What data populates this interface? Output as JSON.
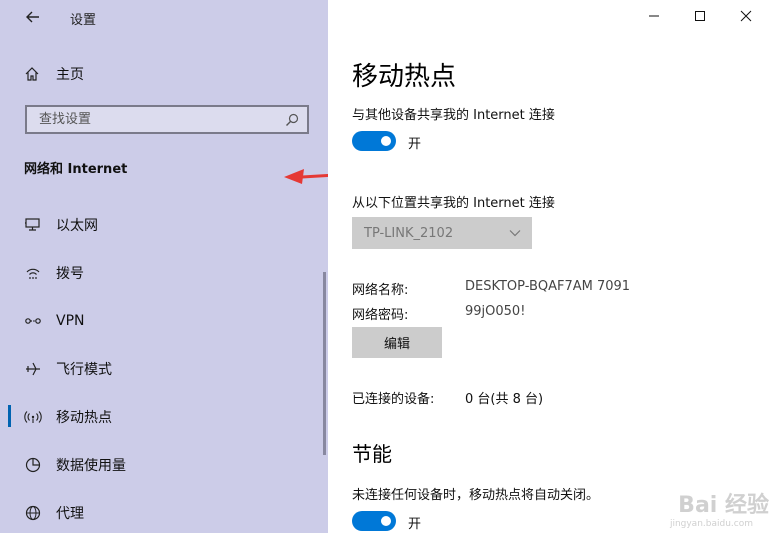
{
  "window": {
    "title": "设置"
  },
  "sidebar": {
    "home_label": "主页",
    "search_placeholder": "查找设置",
    "section_title": "网络和 Internet",
    "items": [
      {
        "label": "以太网",
        "icon": "ethernet-icon"
      },
      {
        "label": "拨号",
        "icon": "dialup-icon"
      },
      {
        "label": "VPN",
        "icon": "vpn-icon"
      },
      {
        "label": "飞行模式",
        "icon": "airplane-icon"
      },
      {
        "label": "移动热点",
        "icon": "hotspot-icon",
        "active": true
      },
      {
        "label": "数据使用量",
        "icon": "data-usage-icon"
      },
      {
        "label": "代理",
        "icon": "globe-icon"
      }
    ]
  },
  "main": {
    "page_title": "移动热点",
    "share_label": "与其他设备共享我的 Internet 连接",
    "share_toggle": {
      "state": "开",
      "on": true
    },
    "share_from_label": "从以下位置共享我的 Internet 连接",
    "share_from_value": "TP-LINK_2102",
    "network_name_label": "网络名称:",
    "network_name_value": "DESKTOP-BQAF7AM 7091",
    "network_password_label": "网络密码:",
    "network_password_value": "99jO050!",
    "edit_button": "编辑",
    "connected_label": "已连接的设备:",
    "connected_value": "0 台(共 8 台)",
    "power_section_title": "节能",
    "power_desc": "未连接任何设备时，移动热点将自动关闭。",
    "power_toggle": {
      "state": "开",
      "on": true
    }
  },
  "watermark": {
    "text": "Bai 经验",
    "sub": "jingyan.baidu.com"
  },
  "colors": {
    "sidebar_bg": "#cccce8",
    "accent": "#0078d7",
    "arrow": "#e53935"
  }
}
